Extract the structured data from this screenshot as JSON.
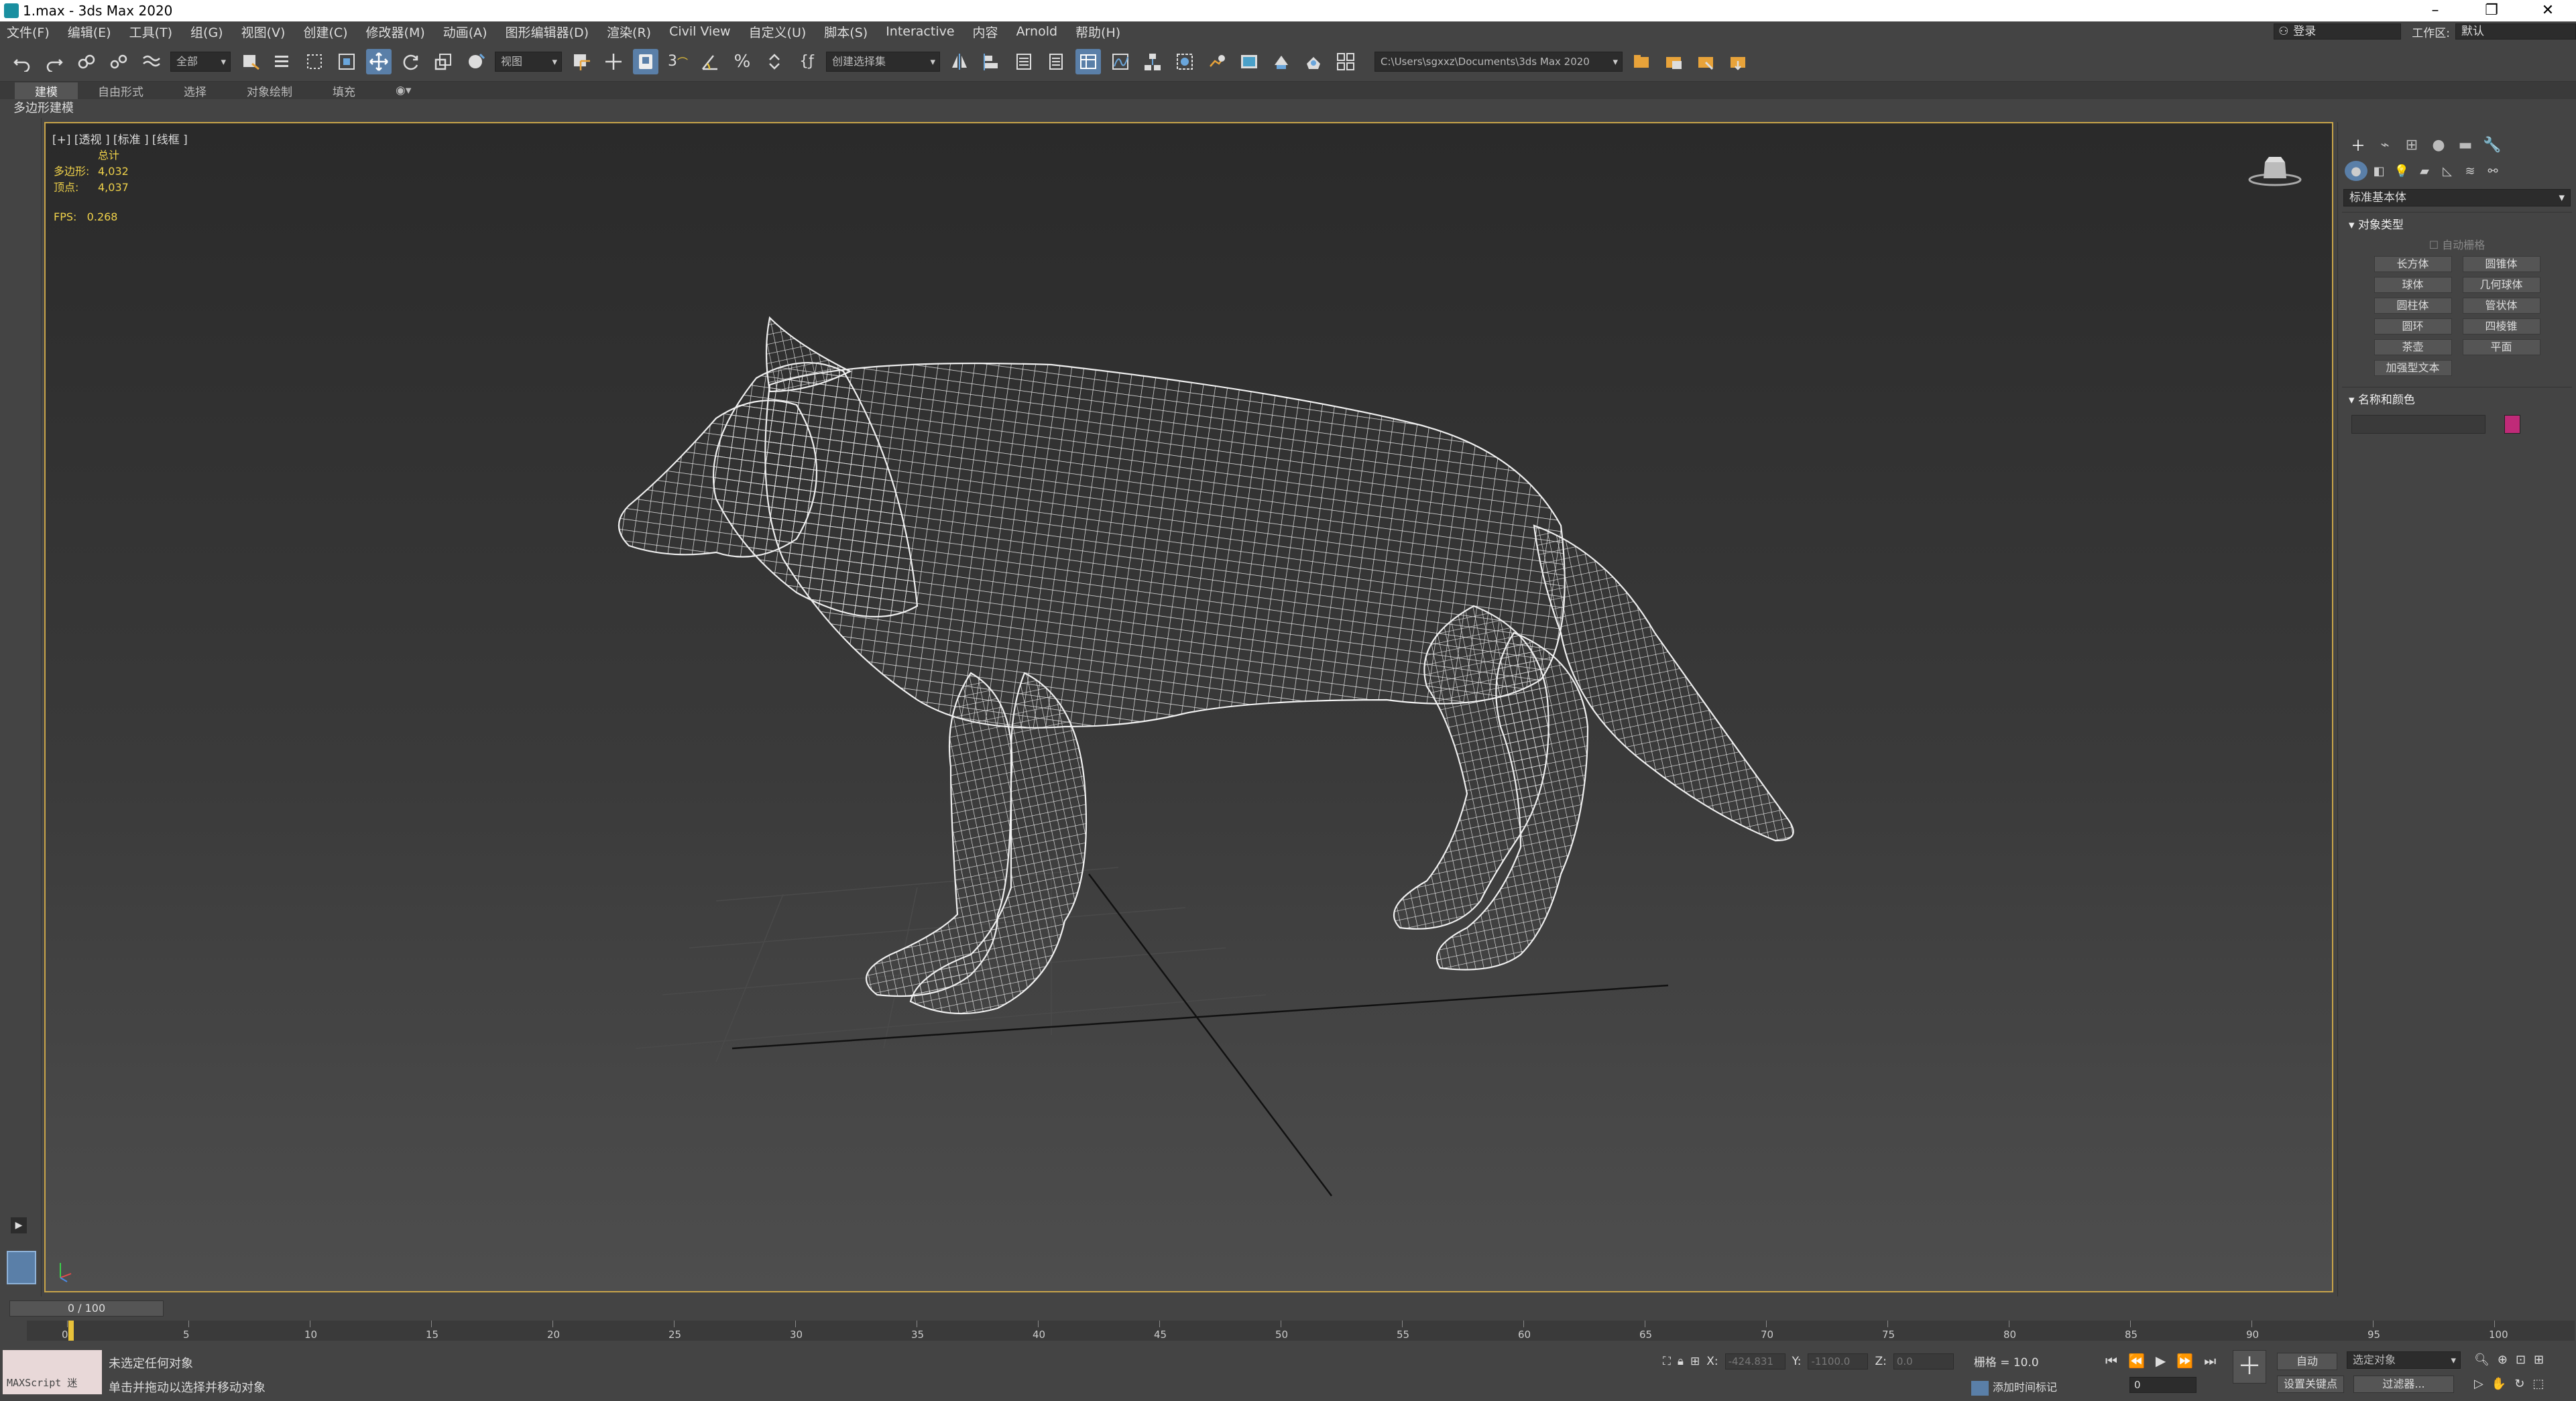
{
  "window": {
    "title": "1.max - 3ds Max 2020",
    "minimize": "–",
    "restore": "❐",
    "close": "✕"
  },
  "menu": [
    "文件(F)",
    "编辑(E)",
    "工具(T)",
    "组(G)",
    "视图(V)",
    "创建(C)",
    "修改器(M)",
    "动画(A)",
    "图形编辑器(D)",
    "渲染(R)",
    "Civil View",
    "自定义(U)",
    "脚本(S)",
    "Interactive",
    "内容",
    "Arnold",
    "帮助(H)"
  ],
  "account": {
    "login": "登录",
    "workspace_label": "工作区:",
    "workspace_value": "默认"
  },
  "toolbar": {
    "filter": "全部",
    "ref_coord": "视图",
    "selection_set": "创建选择集",
    "project_path": "C:\\Users\\sgxxz\\Documents\\3ds Max 2020"
  },
  "ribbon": {
    "tabs": [
      "建模",
      "自由形式",
      "选择",
      "对象绘制",
      "填充"
    ],
    "sub": "多边形建模"
  },
  "viewport": {
    "label": "[+] [透视 ] [标准 ] [线框 ]",
    "stats_header": "总计",
    "poly_label": "多边形:",
    "poly_value": "4,032",
    "vert_label": "顶点:",
    "vert_value": "4,037",
    "fps_label": "FPS:",
    "fps_value": "0.268"
  },
  "command_panel": {
    "category": "标准基本体",
    "rollout_object_type": "对象类型",
    "auto_grid": "自动栅格",
    "objects": [
      "长方体",
      "圆锥体",
      "球体",
      "几何球体",
      "圆柱体",
      "管状体",
      "圆环",
      "四棱锥",
      "茶壶",
      "平面",
      "加强型文本"
    ],
    "rollout_name_color": "名称和颜色",
    "object_color": "#c02a78"
  },
  "timeline": {
    "slider": "0 / 100",
    "ticks": [
      "0",
      "5",
      "10",
      "15",
      "20",
      "25",
      "30",
      "35",
      "40",
      "45",
      "50",
      "55",
      "60",
      "65",
      "70",
      "75",
      "80",
      "85",
      "90",
      "95",
      "100"
    ]
  },
  "status": {
    "maxscript": "MAXScript 迷",
    "line1": "未选定任何对象",
    "line2": "单击并拖动以选择并移动对象",
    "x_label": "X:",
    "x_value": "-424.831",
    "y_label": "Y:",
    "y_value": "-1100.0",
    "z_label": "Z:",
    "z_value": "0.0",
    "grid": "栅格 = 10.0",
    "add_time_tag": "添加时间标记",
    "auto_key": "自动",
    "selected": "选定对象",
    "set_key": "设置关键点",
    "key_filters": "过滤器...",
    "frame": "0"
  }
}
